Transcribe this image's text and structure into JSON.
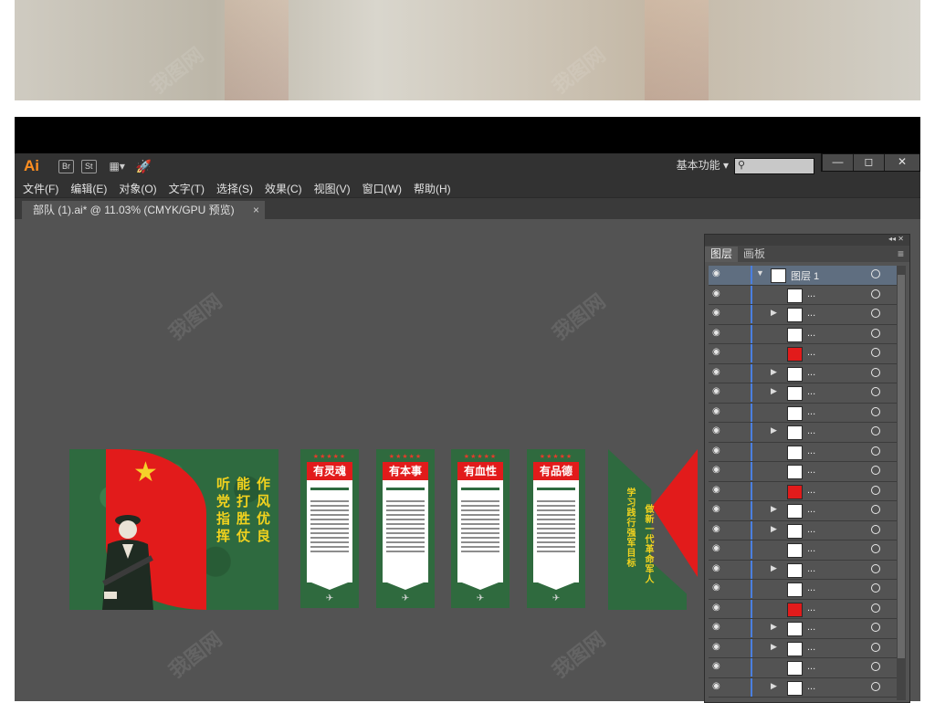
{
  "app": {
    "logo": "Ai",
    "bridge": "Br",
    "stock": "St",
    "workspace": "基本功能",
    "workspace_arrow": "▾"
  },
  "window_controls": [
    "—",
    "◻",
    "✕"
  ],
  "menu": [
    "文件(F)",
    "编辑(E)",
    "对象(O)",
    "文字(T)",
    "选择(S)",
    "效果(C)",
    "视图(V)",
    "窗口(W)",
    "帮助(H)"
  ],
  "document_tab": {
    "title": "部队 (1).ai* @ 11.03% (CMYK/GPU 预览)",
    "close": "×"
  },
  "artwork": {
    "slogans": [
      "听党指挥",
      "能打胜仗",
      "作风优良"
    ],
    "boards": [
      {
        "title": "有灵魂",
        "stars": "★★★★★"
      },
      {
        "title": "有本事",
        "stars": "★★★★★"
      },
      {
        "title": "有血性",
        "stars": "★★★★★"
      },
      {
        "title": "有品德",
        "stars": "★★★★★"
      }
    ],
    "flag_text": [
      "学习践行强军目标",
      "做新一代革命军人"
    ]
  },
  "layers_panel": {
    "tab_layers": "图层",
    "tab_artboards": "画板",
    "top_layer": "图层 1",
    "sublayer_label": "...",
    "row_count": 23
  },
  "watermark": "我图网"
}
